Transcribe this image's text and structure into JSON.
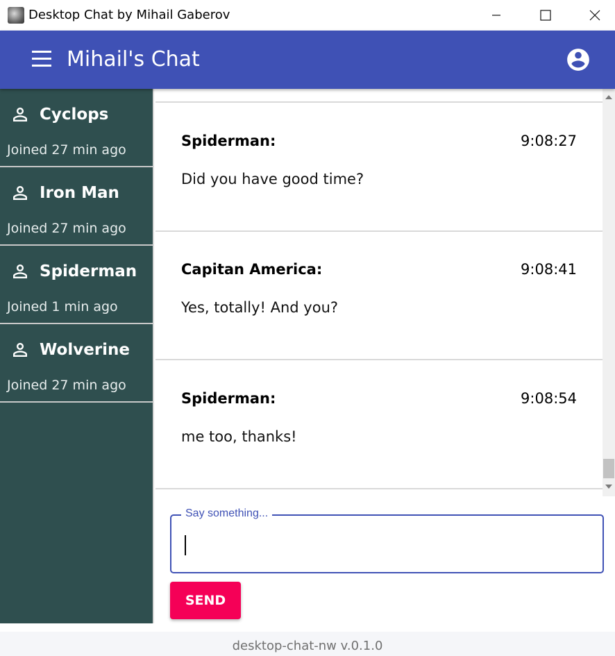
{
  "window": {
    "title": "Desktop Chat by Mihail Gaberov"
  },
  "appbar": {
    "title": "Mihail's Chat"
  },
  "users": [
    {
      "name": "Cyclops",
      "joined": "Joined 27 min ago"
    },
    {
      "name": "Iron Man",
      "joined": "Joined 27 min ago"
    },
    {
      "name": "Spiderman",
      "joined": "Joined 1 min ago"
    },
    {
      "name": "Wolverine",
      "joined": "Joined 27 min ago"
    }
  ],
  "messages": [
    {
      "author": "Spiderman:",
      "time": "9:08:27",
      "text": "Did you have good time?"
    },
    {
      "author": "Capitan America:",
      "time": "9:08:41",
      "text": "Yes, totally! And you?"
    },
    {
      "author": "Spiderman:",
      "time": "9:08:54",
      "text": "me too, thanks!"
    }
  ],
  "composer": {
    "label": "Say something...",
    "value": "",
    "send_label": "SEND"
  },
  "footer": {
    "version": "desktop-chat-nw v.0.1.0"
  },
  "colors": {
    "primary": "#3f51b5",
    "sidebar": "#2f4f4f",
    "accent": "#f50057"
  },
  "icons": {
    "menu": "hamburger-icon",
    "account": "account-circle-icon",
    "user": "person-outline-icon"
  }
}
